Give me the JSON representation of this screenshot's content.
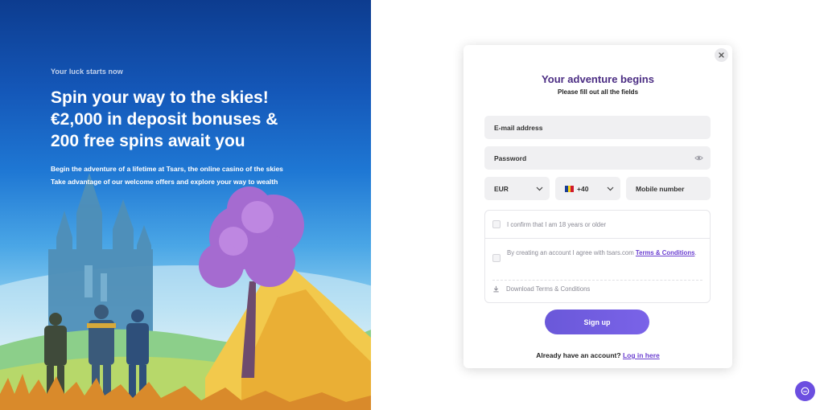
{
  "hero": {
    "kicker": "Your luck starts now",
    "title_line1": "Spin your way to the skies!",
    "title_line2": "€2,000 in deposit bonuses &",
    "title_line3": "200 free spins await you",
    "desc_line1": "Begin the adventure of a lifetime at Tsars, the online casino of the skies",
    "desc_line2": "Take advantage of our welcome offers and explore your way to wealth"
  },
  "form": {
    "title": "Your adventure begins",
    "subtitle": "Please fill out all the fields",
    "email_label": "E-mail address",
    "password_label": "Password",
    "currency": "EUR",
    "phone_code": "+40",
    "mobile_label": "Mobile number",
    "age_confirm": "I confirm that I am 18 years or older",
    "terms_prefix": "By creating an account I agree with tsars.com",
    "terms_link": "Terms & Conditions",
    "terms_suffix": ".",
    "download_terms": "Download Terms & Conditions",
    "signup_label": "Sign up",
    "login_prompt": "Already have an account?",
    "login_link": "Log in here"
  },
  "icons": {
    "close": "close-icon",
    "eye": "eye-icon",
    "chevron": "chevron-down-icon",
    "download": "download-icon",
    "chat": "chat-icon",
    "flag": "romania-flag-icon"
  },
  "colors": {
    "accent": "#6b3fd0",
    "title": "#4b2d83",
    "button": "#6a58d9"
  }
}
